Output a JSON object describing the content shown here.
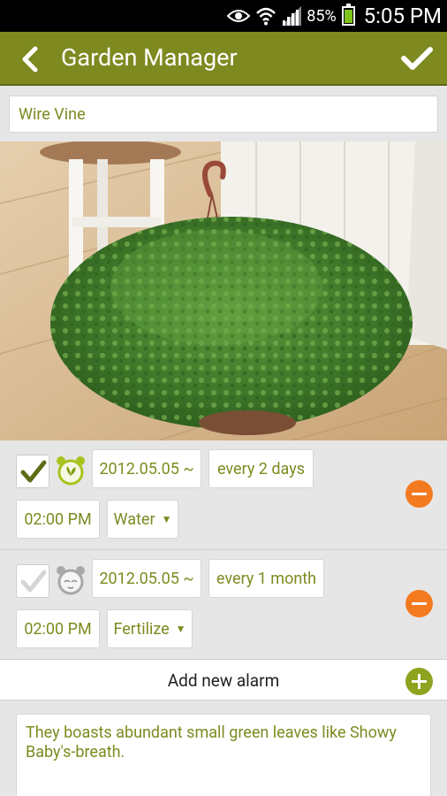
{
  "status_bar": {
    "battery_percent": "85%",
    "battery_level": 0.85,
    "time": "5:05 PM",
    "icons": [
      "eye-icon",
      "wifi-icon",
      "signal-icon",
      "battery-icon"
    ]
  },
  "header": {
    "title": "Garden Manager",
    "back_icon": "chevron-left-icon",
    "confirm_icon": "checkmark-icon",
    "background": "#7e8a20"
  },
  "plant": {
    "name": "Wire Vine",
    "photo": "potted-plant-photo"
  },
  "alarms": [
    {
      "checked": true,
      "icon": "alarm-clock-active-icon",
      "start_date": "2012.05.05 ~",
      "repeat": "every 2 days",
      "time": "02:00 PM",
      "task": "Water"
    },
    {
      "checked": false,
      "icon": "alarm-clock-inactive-icon",
      "start_date": "2012.05.05 ~",
      "repeat": "every 1 month",
      "time": "02:00 PM",
      "task": "Fertilize"
    }
  ],
  "add_alarm": {
    "label": "Add new alarm"
  },
  "notes": {
    "text": "They boasts abundant small green leaves like Showy Baby's-breath."
  },
  "colors": {
    "accent": "#7e8a20",
    "remove": "#f47a1f",
    "add": "#8ea420"
  }
}
